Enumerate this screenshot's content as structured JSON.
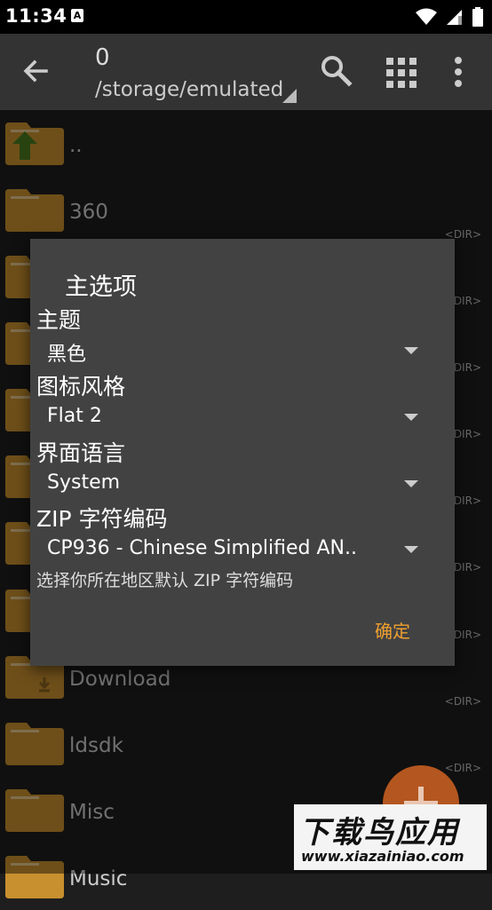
{
  "status_bar": {
    "time": "11:34",
    "app_badge": "A"
  },
  "app_bar": {
    "count": "0",
    "path": "/storage/emulated"
  },
  "files": [
    {
      "name": "..",
      "tag": "",
      "icon": "up-folder-icon"
    },
    {
      "name": "360",
      "tag": "<DIR>",
      "icon": "folder-icon"
    },
    {
      "name": "",
      "tag": "<DIR>",
      "icon": "folder-icon"
    },
    {
      "name": "",
      "tag": "<DIR>",
      "icon": "folder-icon"
    },
    {
      "name": "",
      "tag": "<DIR>",
      "icon": "folder-icon"
    },
    {
      "name": "",
      "tag": "<DIR>",
      "icon": "folder-icon"
    },
    {
      "name": "",
      "tag": "<DIR>",
      "icon": "folder-icon"
    },
    {
      "name": "",
      "tag": "<DIR>",
      "icon": "folder-icon"
    },
    {
      "name": "Download",
      "tag": "<DIR>",
      "icon": "download-folder-icon"
    },
    {
      "name": "ldsdk",
      "tag": "<DIR>",
      "icon": "folder-icon"
    },
    {
      "name": "Misc",
      "tag": "",
      "icon": "folder-icon"
    },
    {
      "name": "Music",
      "tag": "",
      "icon": "folder-icon"
    }
  ],
  "dialog": {
    "title": "主选项",
    "theme_label": "主题",
    "theme_value": "黑色",
    "icon_style_label": "图标风格",
    "icon_style_value": "Flat 2",
    "language_label": "界面语言",
    "language_value": "System",
    "zip_label": "ZIP 字符编码",
    "zip_value": "CP936 - Chinese Simplified AN..",
    "zip_hint": "选择你所在地区默认 ZIP 字符编码",
    "ok_label": "确定"
  },
  "watermark": {
    "title": "下载鸟应用",
    "url": "www.xiazainiao.com"
  },
  "colors": {
    "accent": "#f0a030",
    "folder": "#c8902e",
    "fab": "#b4561f",
    "dialog_bg": "#424242",
    "appbar_bg": "#333333"
  }
}
